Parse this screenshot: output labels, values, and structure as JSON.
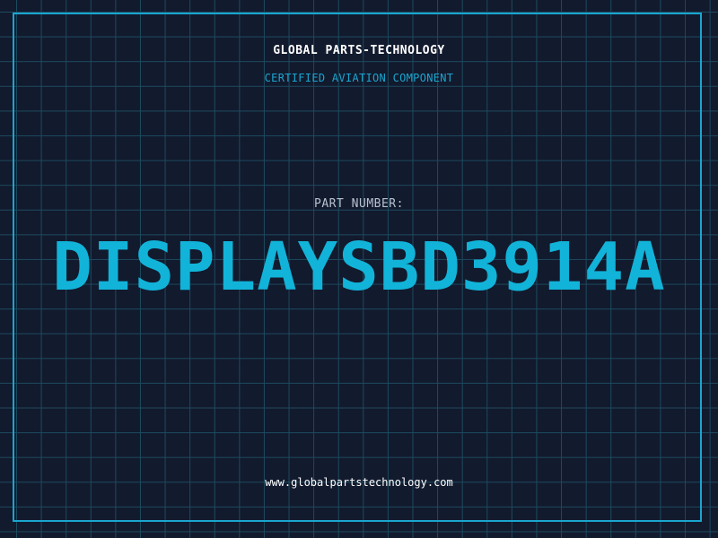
{
  "label": {
    "company": "GLOBAL PARTS-TECHNOLOGY",
    "certification": "CERTIFIED AVIATION COMPONENT",
    "part_number_label": "PART NUMBER:",
    "part_number": "DISPLAYSBD3914A",
    "website": "www.globalpartstechnology.com"
  },
  "colors": {
    "background": "#121a2e",
    "grid": "#1d4a5e",
    "accent": "#1aa6cf",
    "part_number": "#12b3d8",
    "text": "#ffffff",
    "muted": "#b9c2cf"
  }
}
